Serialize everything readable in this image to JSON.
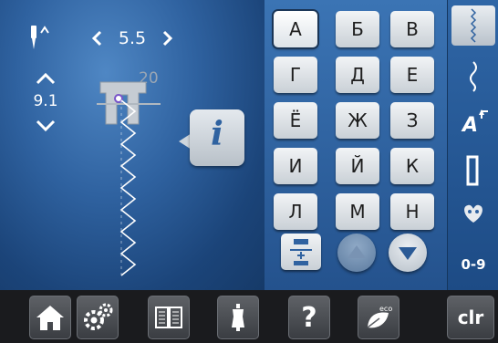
{
  "stitch_settings": {
    "stitch_width": "5.5",
    "stitch_length": "9.1",
    "presser_foot_number": "20"
  },
  "alphabet_grid": [
    "А",
    "Б",
    "В",
    "Г",
    "Д",
    "Е",
    "Ё",
    "Ж",
    "З",
    "И",
    "Й",
    "К",
    "Л",
    "М",
    "Н"
  ],
  "selected_letter": "А",
  "info_label": "i",
  "side_menu": {
    "lowercase_label": "A",
    "numbers_label": "0-9"
  },
  "bottom_bar": {
    "clear_label": "clr",
    "eco_label": "eco",
    "help_label": "?"
  },
  "colors": {
    "panel_blue": "#2f62a0",
    "button_gray": "#d8dde2",
    "bottom_bar": "#1a1b1e"
  },
  "icons": [
    "needle-position-icon",
    "home-icon",
    "setup-icon",
    "tutorial-icon",
    "creative-consultant-icon",
    "help-icon",
    "eco-icon",
    "clear-icon"
  ]
}
